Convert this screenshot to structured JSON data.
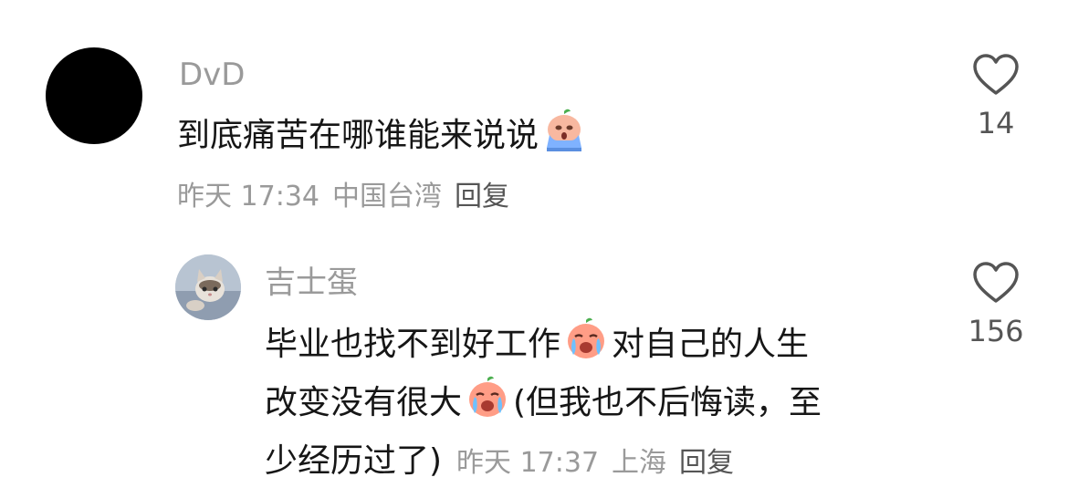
{
  "comments": [
    {
      "username": "DvD",
      "text": "到底痛苦在哪谁能来说说",
      "emoji": "crying-face-icon",
      "time": "昨天 17:34",
      "location": "中国台湾",
      "reply_label": "回复",
      "likes": "14"
    },
    {
      "username": "吉士蛋",
      "line1_a": "毕业也找不到好工作",
      "line1_b": "对自己的人生",
      "line2_a": "改变没有很大",
      "line2_b": "(但我也不后悔读，至",
      "line3": "少经历过了)",
      "emoji": "crying-face-icon",
      "time": "昨天 17:37",
      "location": "上海",
      "reply_label": "回复",
      "likes": "156"
    }
  ],
  "colors": {
    "muted": "#9a9a9a",
    "text": "#161616",
    "icon": "#555555"
  }
}
